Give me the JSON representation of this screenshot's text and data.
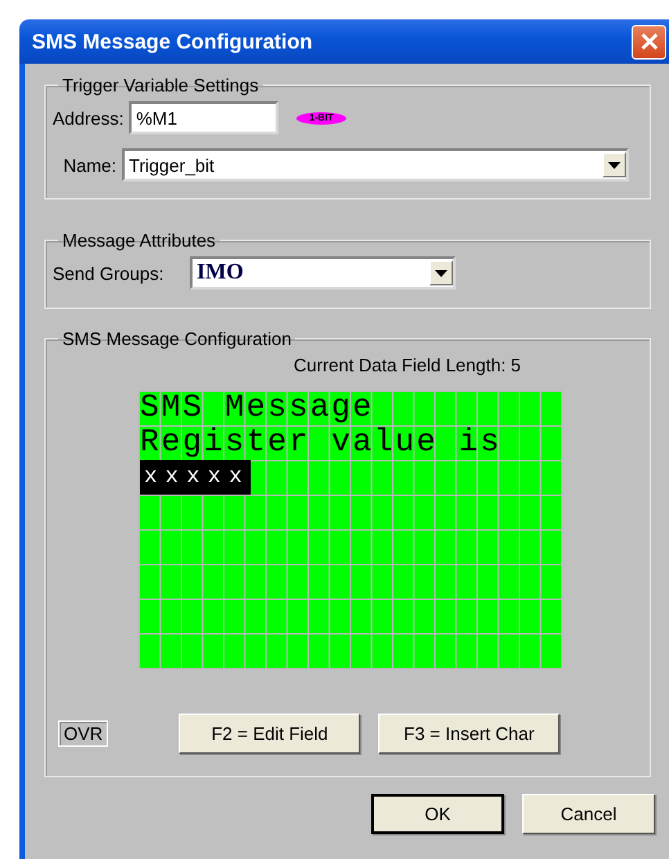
{
  "window": {
    "title": "SMS Message Configuration"
  },
  "trigger_group": {
    "title": "Trigger Variable Settings",
    "address_label": "Address:",
    "address_value": "%M1",
    "badge": "1-BIT",
    "name_label": "Name:",
    "name_value": "Trigger_bit"
  },
  "attributes_group": {
    "title": "Message Attributes",
    "send_groups_label": "Send Groups:",
    "send_groups_value": "IMO"
  },
  "sms_group": {
    "title": "SMS Message Configuration",
    "field_length": "Current Data Field Length: 5",
    "lcd_lines": [
      {
        "text": "SMS Message",
        "kind": "text"
      },
      {
        "text": "Register value is",
        "kind": "text"
      },
      {
        "text": "xxxxx",
        "kind": "field"
      }
    ],
    "mode": "OVR",
    "buttons": [
      "F2 = Edit Field",
      "F3 = Insert Char"
    ]
  },
  "buttons": [
    {
      "label": "OK",
      "default": true
    },
    {
      "label": "Cancel",
      "default": false
    }
  ]
}
